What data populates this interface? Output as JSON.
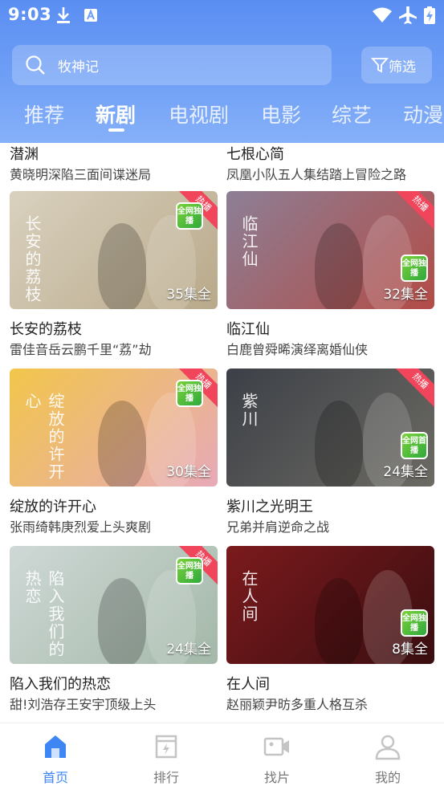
{
  "status_bar": {
    "time": "9:03"
  },
  "search": {
    "placeholder": "牧神记"
  },
  "filter": {
    "label": "筛选"
  },
  "tabs": [
    {
      "label": "推荐",
      "active": false
    },
    {
      "label": "新剧",
      "active": true
    },
    {
      "label": "电视剧",
      "active": false
    },
    {
      "label": "电影",
      "active": false
    },
    {
      "label": "综艺",
      "active": false
    },
    {
      "label": "动漫",
      "active": false
    }
  ],
  "partial_row": [
    {
      "title": "潜渊",
      "subtitle": "黄晓明深陷三面间谍迷局"
    },
    {
      "title": "七根心简",
      "subtitle": "凤凰小队五人集结踏上冒险之路"
    }
  ],
  "cards": [
    {
      "title": "长安的荔枝",
      "subtitle": "雷佳音岳云鹏千里“荔”劫",
      "episodes": "35集全",
      "ribbon": "热播",
      "badge": "全网独播",
      "poster_text": "长安的荔枝",
      "palette": [
        "#d9d1bf",
        "#b9a98a"
      ]
    },
    {
      "title": "临江仙",
      "subtitle": "白鹿曾舜晞演绎离婚仙侠",
      "episodes": "32集全",
      "ribbon": "热播",
      "badge": "全网独播",
      "poster_text": "临江仙",
      "palette": [
        "#8c7f96",
        "#b34c46"
      ]
    },
    {
      "title": "绽放的许开心",
      "subtitle": "张雨绮韩庚烈爱上头爽剧",
      "episodes": "30集全",
      "ribbon": "热播",
      "badge": "全网独播",
      "poster_text": "绽放的许开心",
      "palette": [
        "#f2c64b",
        "#e7a9b8"
      ]
    },
    {
      "title": "紫川之光明王",
      "subtitle": "兄弟并肩逆命之战",
      "episodes": "24集全",
      "ribbon": "热播",
      "badge": "全网首播",
      "poster_text": "紫川",
      "palette": [
        "#3c4047",
        "#6c6a63"
      ]
    },
    {
      "title": "陷入我们的热恋",
      "subtitle": "甜!刘浩存王安宇顶级上头",
      "episodes": "24集全",
      "ribbon": "热播",
      "badge": "全网独播",
      "poster_text": "陷入我们的热恋",
      "palette": [
        "#cfd8d6",
        "#a3b8a8"
      ]
    },
    {
      "title": "在人间",
      "subtitle": "赵丽颖尹昉多重人格互杀",
      "episodes": "8集全",
      "ribbon": "",
      "badge": "全网独播",
      "poster_text": "在人间",
      "palette": [
        "#7b1a1d",
        "#3a0e10"
      ]
    }
  ],
  "bottom_nav": [
    {
      "label": "首页",
      "icon": "home-icon",
      "active": true
    },
    {
      "label": "排行",
      "icon": "ranking-icon",
      "active": false
    },
    {
      "label": "找片",
      "icon": "video-camera-icon",
      "active": false
    },
    {
      "label": "我的",
      "icon": "user-icon",
      "active": false
    }
  ],
  "colors": {
    "accent": "#3f86f5",
    "header": "#6f9ff6",
    "ribbon": "#f0455a",
    "badge": "#4cbf3a"
  }
}
